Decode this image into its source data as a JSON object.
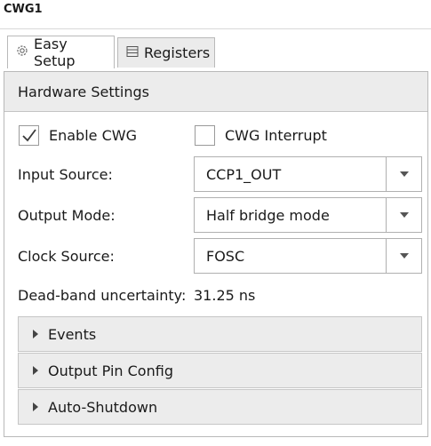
{
  "window": {
    "title": "CWG1"
  },
  "tabs": [
    {
      "label": "Easy Setup",
      "icon": "gear-icon",
      "active": true
    },
    {
      "label": "Registers",
      "icon": "list-icon",
      "active": false
    }
  ],
  "hardware": {
    "header": "Hardware Settings",
    "enable_cwg": {
      "label": "Enable CWG",
      "checked": true
    },
    "cwg_interrupt": {
      "label": "CWG Interrupt",
      "checked": false
    },
    "input_source": {
      "label": "Input Source:",
      "value": "CCP1_OUT"
    },
    "output_mode": {
      "label": "Output Mode:",
      "value": "Half bridge mode"
    },
    "clock_source": {
      "label": "Clock Source:",
      "value": "FOSC"
    },
    "dead_band": {
      "label": "Dead-band uncertainty:",
      "value": "31.25 ns"
    }
  },
  "sections": [
    {
      "label": "Events"
    },
    {
      "label": "Output Pin Config"
    },
    {
      "label": "Auto-Shutdown"
    }
  ]
}
